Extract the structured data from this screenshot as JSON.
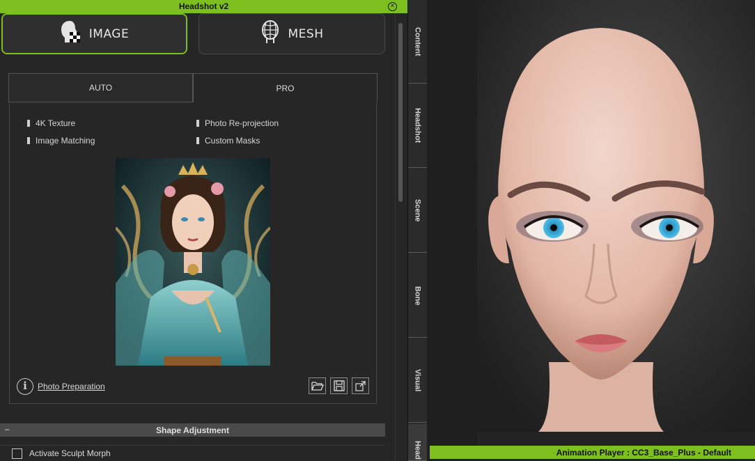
{
  "window": {
    "title": "Headshot v2"
  },
  "modes": [
    {
      "label": "IMAGE",
      "icon": "image-head-icon",
      "active": true
    },
    {
      "label": "MESH",
      "icon": "mesh-head-icon",
      "active": false
    }
  ],
  "subtabs": [
    {
      "label": "AUTO",
      "active": false
    },
    {
      "label": "PRO",
      "active": true
    }
  ],
  "features": [
    "4K Texture",
    "Photo Re-projection",
    "Image Matching",
    "Custom Masks"
  ],
  "photo_prep": {
    "link": "Photo Preparation"
  },
  "tools": [
    "open-folder-icon",
    "save-icon",
    "export-icon"
  ],
  "shape_section": {
    "title": "Shape Adjustment",
    "collapse_glyph": "–"
  },
  "sculpt": {
    "label": "Activate Sculpt Morph",
    "checked": false
  },
  "side_tabs": [
    "Content",
    "Headshot",
    "Scene",
    "Bone",
    "Visual",
    "Head"
  ],
  "player": {
    "status": "Animation Player : CC3_Base_Plus - Default"
  },
  "colors": {
    "accent": "#7cbf1f",
    "panel_bg": "#262626"
  }
}
